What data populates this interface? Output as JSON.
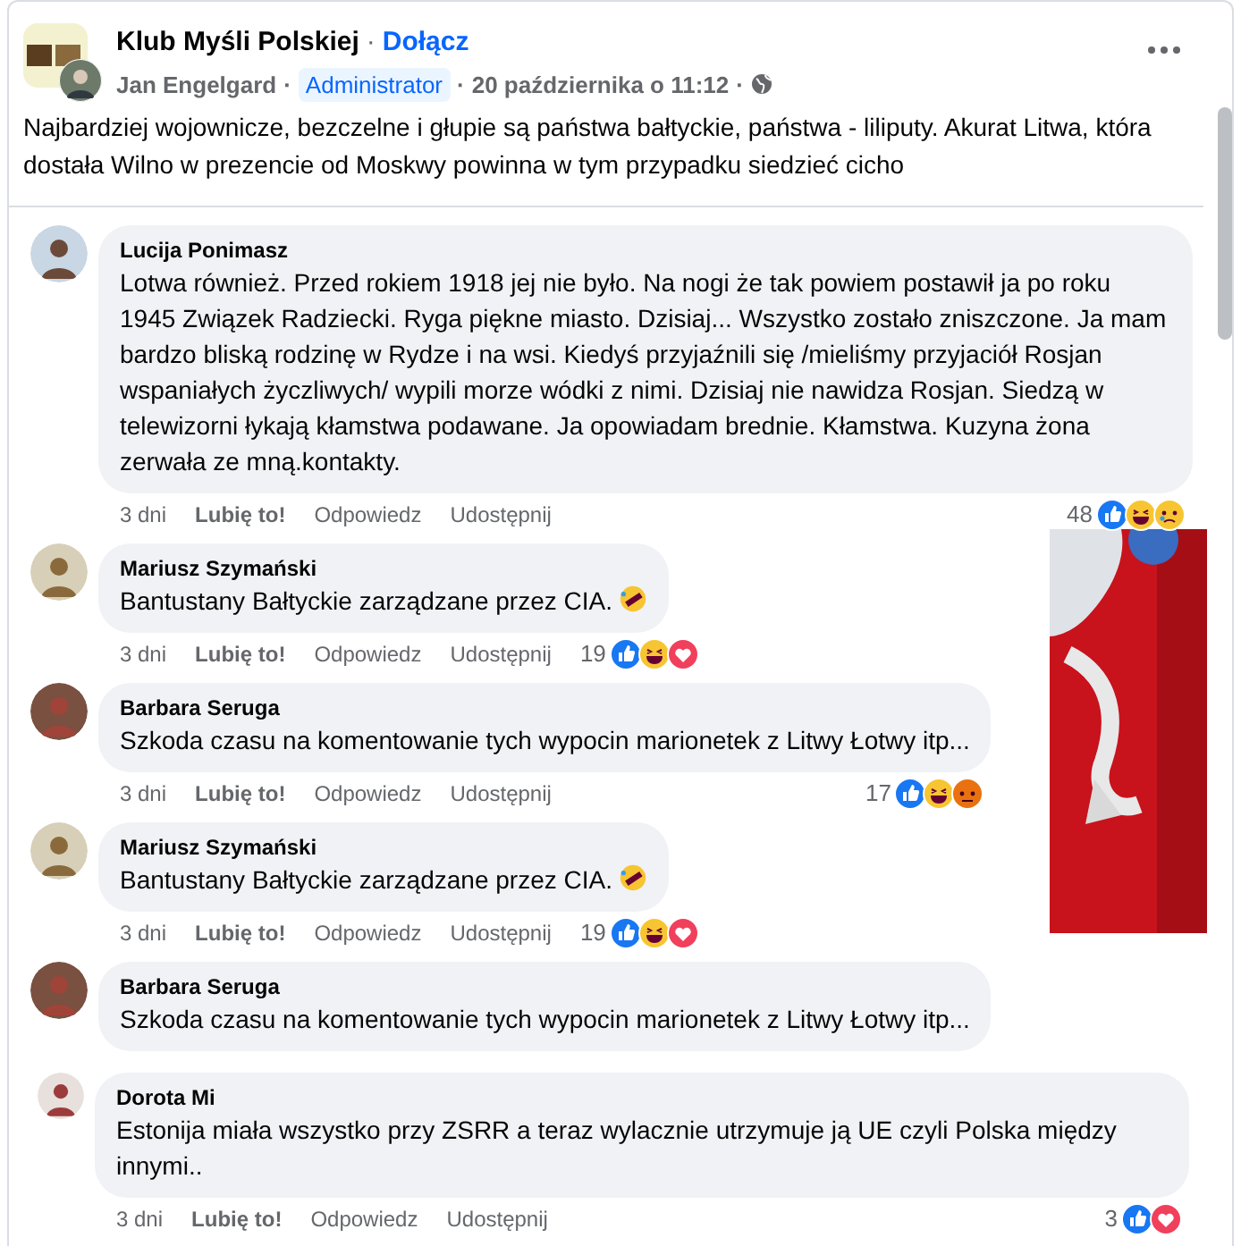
{
  "post": {
    "group": "Klub Myśli Polskiej",
    "separator": "·",
    "join": "Dołącz",
    "author": "Jan Engelgard",
    "badge": "Administrator",
    "date": "20 października o 11:12",
    "text": "Najbardziej wojownicze, bezczelne i głupie są państwa bałtyckie, państwa - liliputy. Akurat Litwa, która dostała Wilno w prezencie od Moskwy powinna w tym przypadku siedzieć cicho"
  },
  "comments": [
    {
      "name": "Lucija Ponimasz",
      "text": "Lotwa również. Przed rokiem 1918 jej nie było. Na nogi że tak powiem postawił ja po roku 1945 Związek Radziecki. Ryga piękne miasto. Dzisiaj... Wszystko zostało zniszczone. Ja mam bardzo bliską rodzinę w Rydze i na wsi. Kiedyś przyjaźnili się /mieliśmy przyjaciół Rosjan wspaniałych życzliwych/ wypili morze wódki z nimi. Dzisiaj nie nawidza Rosjan. Siedzą w telewizorni łykają kłamstwa podawane. Ja opowiadam brednie. Kłamstwa. Kuzyna żona zerwała ze mną.kontakty.",
      "emoji": false,
      "reply": false,
      "actions": {
        "time": "3 dni",
        "like": "Lubię to!",
        "reply": "Odpowiedz",
        "share": "Udostępnij",
        "count": "48",
        "reactions": [
          {
            "kind": "like"
          },
          {
            "kind": "haha"
          },
          {
            "kind": "sad"
          }
        ]
      }
    },
    {
      "name": "Mariusz Szymański",
      "text": "Bantustany Bałtyckie zarządzane przez CIA.",
      "emoji": true,
      "reply": false,
      "actions": {
        "time": "3 dni",
        "like": "Lubię to!",
        "reply": "Odpowiedz",
        "share": "Udostępnij",
        "count": "19",
        "reactions": [
          {
            "kind": "like"
          },
          {
            "kind": "haha"
          },
          {
            "kind": "love"
          }
        ]
      }
    },
    {
      "name": "Barbara Seruga",
      "text": "Szkoda czasu na komentowanie tych wypocin marionetek z Litwy Łotwy itp...",
      "emoji": false,
      "reply": false,
      "actions": {
        "time": "3 dni",
        "like": "Lubię to!",
        "reply": "Odpowiedz",
        "share": "Udostępnij",
        "count": "17",
        "reactions": [
          {
            "kind": "like"
          },
          {
            "kind": "haha"
          },
          {
            "kind": "angry"
          }
        ]
      }
    },
    {
      "name": "Mariusz Szymański",
      "text": "Bantustany Bałtyckie zarządzane przez CIA.",
      "emoji": true,
      "reply": false,
      "actions": {
        "time": "3 dni",
        "like": "Lubię to!",
        "reply": "Odpowiedz",
        "share": "Udostępnij",
        "count": "19",
        "reactions": [
          {
            "kind": "like"
          },
          {
            "kind": "haha"
          },
          {
            "kind": "love"
          }
        ]
      }
    },
    {
      "name": "Barbara Seruga",
      "text": "Szkoda czasu na komentowanie tych wypocin marionetek z Litwy Łotwy itp...",
      "emoji": false,
      "reply": false
    },
    {
      "name": "Dorota Mi",
      "text": "Estonija miała wszystko przy ZSRR a teraz wylacznie utrzymuje ją UE czyli Polska między innymi..",
      "emoji": false,
      "reply": true,
      "actions": {
        "time": "3 dni",
        "like": "Lubię to!",
        "reply": "Odpowiedz",
        "share": "Udostępnij",
        "count": "3",
        "reactions": [
          {
            "kind": "like"
          },
          {
            "kind": "love"
          }
        ]
      }
    }
  ]
}
